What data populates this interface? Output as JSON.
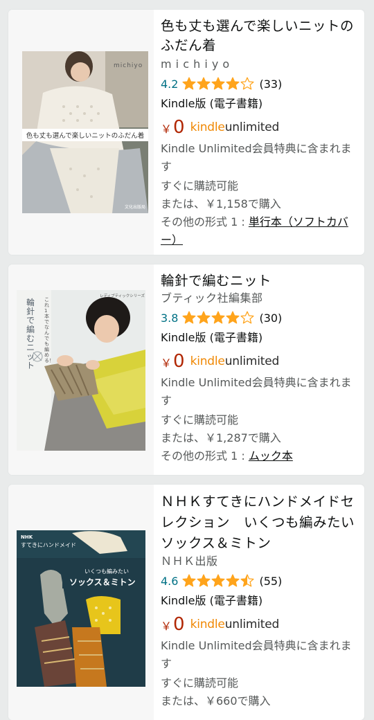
{
  "colors": {
    "star": "#ffa41c",
    "price": "#b12704",
    "rating": "#007185",
    "ku_orange": "#f08804"
  },
  "products": [
    {
      "title": "色も丈も選んで楽しいニットのふだん着",
      "author": "m i c h i y o",
      "rating": "4.2",
      "stars": 4.2,
      "reviews": "(33)",
      "format": "Kindle版 (電子書籍)",
      "currency": "￥",
      "price": "0",
      "ku_kindle": "kindle",
      "ku_unlimited": "unlimited",
      "ku_included": "Kindle Unlimited会員特典に含まれます",
      "available": "すぐに購読可能",
      "or_buy": "または、￥1,158で購入",
      "other_prefix": "その他の形式 1 : ",
      "other_link": "単行本（ソフトカバー）",
      "cover": {
        "brand": "michiyo",
        "caption": "色も丈も選んで楽しいニットのふだん着",
        "publisher": "文化出版局"
      }
    },
    {
      "title": "輪針で編むニット",
      "author": "ブティック社編集部",
      "rating": "3.8",
      "stars": 3.8,
      "reviews": "(30)",
      "format": "Kindle版 (電子書籍)",
      "currency": "￥",
      "price": "0",
      "ku_kindle": "kindle",
      "ku_unlimited": "unlimited",
      "ku_included": "Kindle Unlimited会員特典に含まれます",
      "available": "すぐに購読可能",
      "or_buy": "または、￥1,287で購入",
      "other_prefix": "その他の形式 1 : ",
      "other_link": "ムック本",
      "cover": {
        "series": "レディブティックシリーズ",
        "tag": "これ1本でなんでも編める！",
        "title": "輪針で編むニット"
      }
    },
    {
      "title": "ＮＨＫすてきにハンドメイドセレクション　いくつも編みたいソックス＆ミトン",
      "author": "ＮＨＫ出版",
      "rating": "4.6",
      "stars": 4.6,
      "reviews": "(55)",
      "format": "Kindle版 (電子書籍)",
      "currency": "￥",
      "price": "0",
      "ku_kindle": "kindle",
      "ku_unlimited": "unlimited",
      "ku_included": "Kindle Unlimited会員特典に含まれます",
      "available": "すぐに購読可能",
      "or_buy": "または、￥660で購入",
      "cover": {
        "brand": "NHK",
        "series": "すてきにハンドメイド",
        "subtitle": "いくつも編みたい",
        "title": "ソックス＆ミトン"
      }
    }
  ]
}
